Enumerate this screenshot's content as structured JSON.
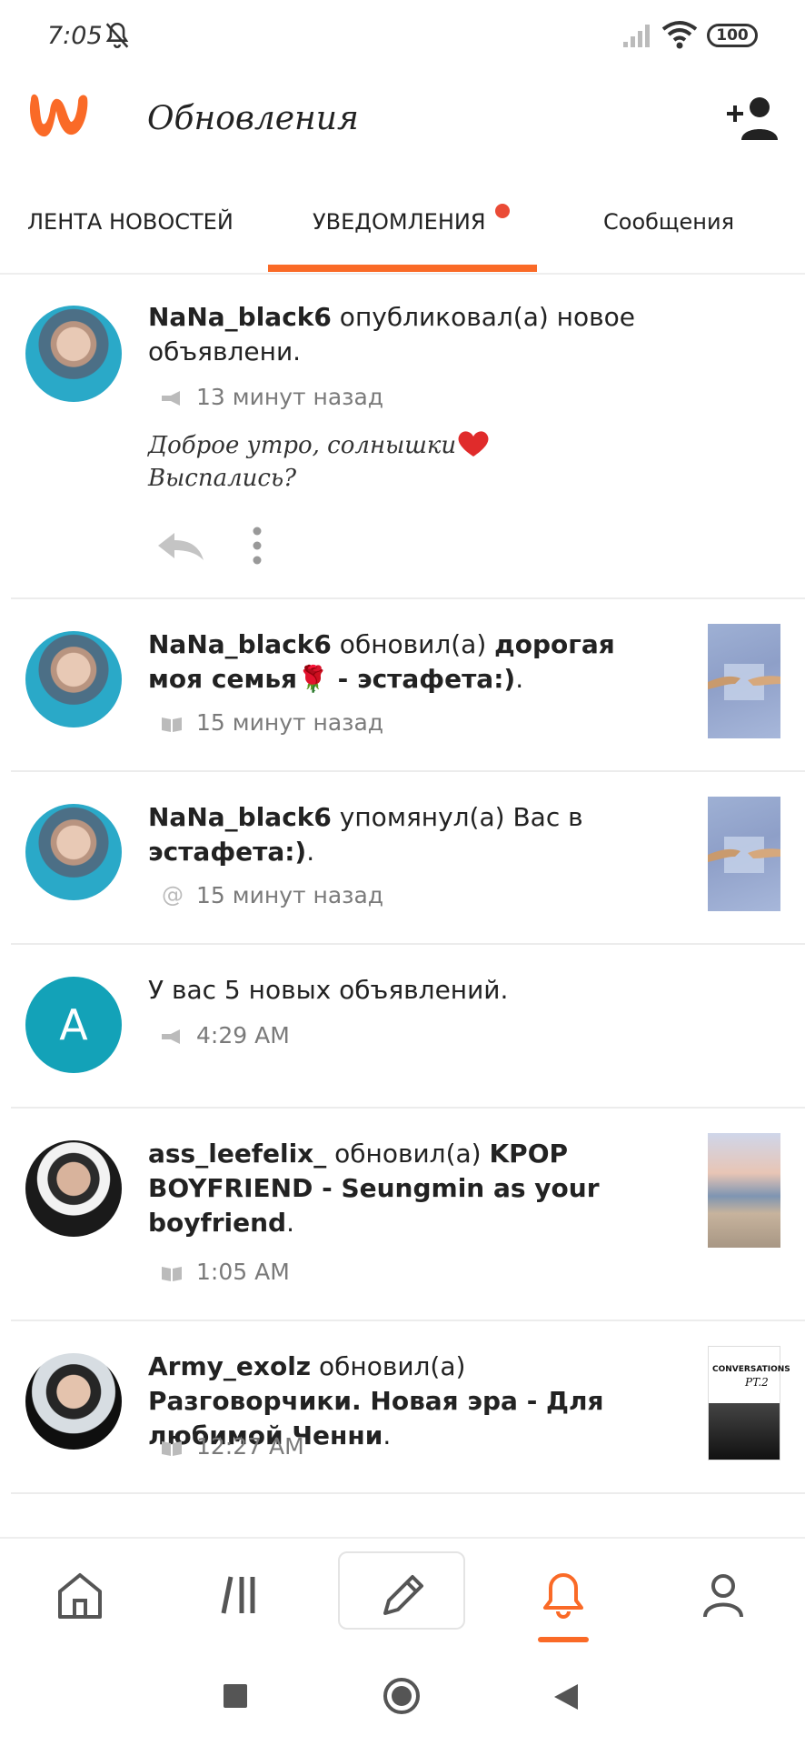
{
  "status_bar": {
    "time": "7:05",
    "battery": "100",
    "icons": [
      "bell-off-icon",
      "signal-icon",
      "wifi-icon",
      "battery-icon"
    ]
  },
  "header": {
    "title": "Обновления",
    "logo": "wattpad-logo",
    "action_icon": "add-user-icon"
  },
  "tabs": [
    {
      "label": "ЛЕНТА НОВОСТЕЙ"
    },
    {
      "label": "УВЕДОМЛЕНИЯ",
      "active": true,
      "badge": true
    },
    {
      "label": "Сообщения"
    }
  ],
  "colors": {
    "accent": "#fa6a27",
    "badge": "#ea4b36",
    "avatar_letter_bg": "#13a2b8",
    "meta_text": "#777777"
  },
  "feed": [
    {
      "user": "NaNa_black6",
      "action": " опубликовал(а) новое объявлени.",
      "meta_icon": "megaphone-icon",
      "time": "13 минут назад",
      "message_line1": "Доброе утро, солнышки",
      "message_line2": "Выспались?",
      "actions": [
        "reply-icon",
        "more-vertical-icon"
      ]
    },
    {
      "user": "NaNa_black6",
      "action": " обновил(а) ",
      "story": "дорогая моя семья🌹 - эстафета:)",
      "end": ".",
      "meta_icon": "book-icon",
      "time": "15 минут назад"
    },
    {
      "user": "NaNa_black6",
      "action": " упомянул(а) Вас в ",
      "story": "эстафета:)",
      "end": ".",
      "meta_icon": "at-icon",
      "time": "15 минут назад"
    },
    {
      "avatar_letter": "A",
      "action": "У вас 5 новых объявлений.",
      "meta_icon": "megaphone-icon",
      "time": "4:29 AM"
    },
    {
      "user": "ass_leefelix_",
      "action": " обновил(а) ",
      "story": "KPOP BOYFRIEND - Seungmin as your boyfriend",
      "end": ".",
      "meta_icon": "book-icon",
      "time": "1:05 AM"
    },
    {
      "user": "Army_exolz",
      "action": " обновил(а) ",
      "story": "Разговорчики. Новая эра - Для любимой Ченни",
      "end": ".",
      "meta_icon": "book-icon",
      "time": "12:27 AM",
      "thumb_title": "CONVERSATIONS",
      "thumb_sub": "PT.2"
    }
  ],
  "bottom_nav": [
    "home-icon",
    "library-icon",
    "pencil-icon",
    "bell-icon",
    "profile-icon"
  ],
  "system_nav": [
    "recents-icon",
    "home-circle-icon",
    "back-icon"
  ]
}
